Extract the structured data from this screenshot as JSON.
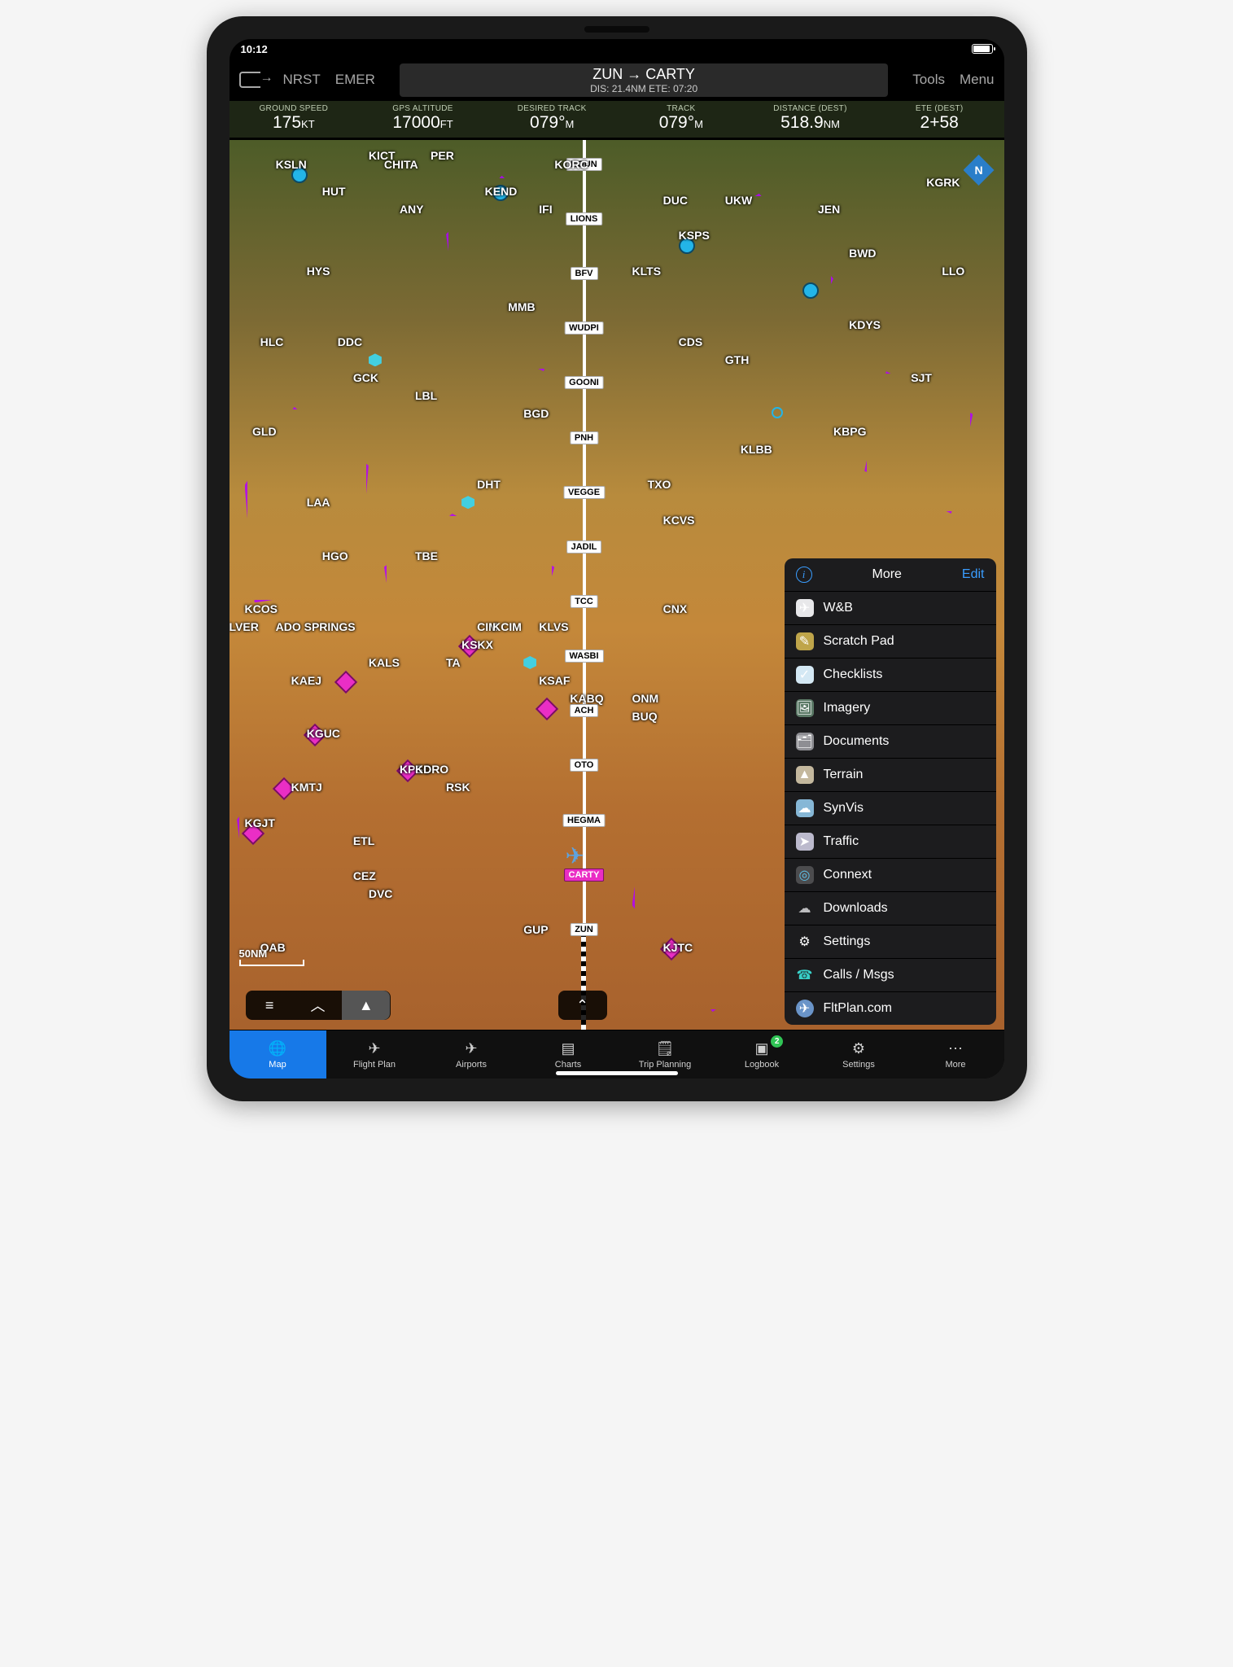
{
  "status_bar": {
    "time": "10:12"
  },
  "toolbar": {
    "nrst_label": "NRST",
    "emer_label": "EMER",
    "route_title": "ZUN → CARTY",
    "route_sub": "DIS: 21.4NM   ETE: 07:20",
    "tools_label": "Tools",
    "menu_label": "Menu"
  },
  "info_strip": [
    {
      "label": "GROUND SPEED",
      "value": "175",
      "unit": "KT"
    },
    {
      "label": "GPS ALTITUDE",
      "value": "17000",
      "unit": "FT"
    },
    {
      "label": "DESIRED TRACK",
      "value": "079°",
      "unit": "M"
    },
    {
      "label": "TRACK",
      "value": "079°",
      "unit": "M"
    },
    {
      "label": "DISTANCE (DEST)",
      "value": "518.9",
      "unit": "NM"
    },
    {
      "label": "ETE (DEST)",
      "value": "2+58",
      "unit": ""
    }
  ],
  "scale_label": "50NM",
  "compass_label": "N",
  "waypoints": [
    "KOUN",
    "LIONS",
    "BFV",
    "WUDPI",
    "GOONI",
    "PNH",
    "VEGGE",
    "JADIL",
    "TCC",
    "WASBI",
    "ACH",
    "OTO",
    "HEGMA",
    "CARTY",
    "ZUN"
  ],
  "map_pills": {
    "layers": "☰",
    "terrain": "▴",
    "north": "▲",
    "caret": "⌃"
  },
  "map_labels": [
    "KSLN",
    "KICT",
    "PER",
    "HUT",
    "KEND",
    "ANY",
    "IFI",
    "DUC",
    "UKW",
    "JEN",
    "KGRK",
    "HYS",
    "MMB",
    "HLC",
    "DDC",
    "GCK",
    "LBL",
    "BGD",
    "CDS",
    "GTH",
    "SJT",
    "GLD",
    "LAA",
    "DHT",
    "TXO",
    "KCVS",
    "HGO",
    "TBE",
    "KCOS",
    "CIM",
    "KLVS",
    "CNX",
    "KALS",
    "KSKX",
    "TA",
    "KSAF",
    "KABQ",
    "ONM",
    "KAEJ",
    "KGUC",
    "KPSO",
    "KDRO",
    "RSK",
    "KMTJ",
    "KGJT",
    "ETL",
    "CEZ",
    "DVC",
    "GUP",
    "KJTC",
    "OAB",
    "KSPS",
    "KLTS",
    "BWD",
    "LLO",
    "KDYS",
    "KLBB",
    "KBPG",
    "KORC",
    "KCIM",
    "BUQ",
    "LVER",
    "ADO SPRINGS",
    "CHITA"
  ],
  "more_panel": {
    "title": "More",
    "info": "i",
    "edit": "Edit",
    "items": [
      {
        "id": "wb",
        "label": "W&B"
      },
      {
        "id": "sp",
        "label": "Scratch Pad"
      },
      {
        "id": "ck",
        "label": "Checklists"
      },
      {
        "id": "im",
        "label": "Imagery"
      },
      {
        "id": "doc",
        "label": "Documents"
      },
      {
        "id": "ter",
        "label": "Terrain"
      },
      {
        "id": "sv",
        "label": "SynVis"
      },
      {
        "id": "tr",
        "label": "Traffic"
      },
      {
        "id": "cx",
        "label": "Connext"
      },
      {
        "id": "dl",
        "label": "Downloads"
      },
      {
        "id": "st",
        "label": "Settings"
      },
      {
        "id": "cm",
        "label": "Calls / Msgs"
      },
      {
        "id": "fp",
        "label": "FltPlan.com"
      }
    ]
  },
  "tabbar": {
    "active": "Map",
    "badge_logbook": "2",
    "items": [
      {
        "id": "map",
        "label": "Map"
      },
      {
        "id": "fpl",
        "label": "Flight Plan"
      },
      {
        "id": "apt",
        "label": "Airports"
      },
      {
        "id": "chr",
        "label": "Charts"
      },
      {
        "id": "trip",
        "label": "Trip Planning"
      },
      {
        "id": "log",
        "label": "Logbook"
      },
      {
        "id": "set",
        "label": "Settings"
      },
      {
        "id": "more",
        "label": "More"
      }
    ]
  }
}
